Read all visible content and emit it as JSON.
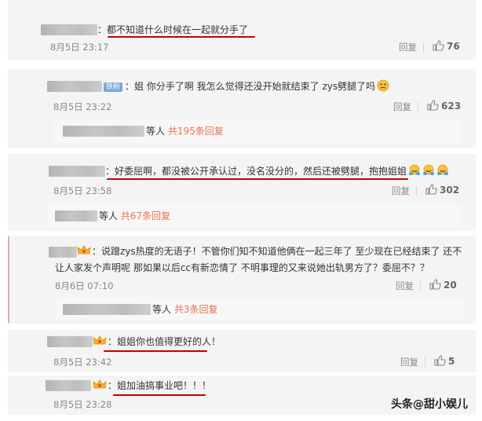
{
  "comments": [
    {
      "text": "：都不知道什么时候在一起就分手了",
      "time": "8月5日 23:17",
      "reply_label": "回复",
      "likes": "76"
    },
    {
      "badge": "铁粉",
      "text": "：姐 你分手了啊 我怎么觉得还没开始就结束了 zys劈腿了吗",
      "time": "8月5日 23:22",
      "reply_label": "回复",
      "likes": "623",
      "replies_prefix": "等人",
      "replies_link": "共195条回复"
    },
    {
      "text": "：好委屈啊，都没被公开承认过，没名没分的，然后还被劈腿，抱抱姐姐",
      "time": "8月5日 23:58",
      "reply_label": "回复",
      "likes": "302",
      "replies_prefix": "等人",
      "replies_link": "共67条回复"
    },
    {
      "text_line1": "：说蹭zys热度的无语子！不管你们知不知道他俩在一起三年了 至少现在已经结束了 还不",
      "text_line2": "让人家发个声明呢 那如果以后cc有新恋情了 不明事理的又来说她出轨男方了？委屈不？？",
      "time": "8月6日 07:10",
      "reply_label": "回复",
      "likes": "20",
      "replies_prefix": "等人",
      "replies_link": "共3条回复"
    },
    {
      "text": "：姐姐你也值得更好的人！",
      "time": "8月5日 23:42",
      "reply_label": "回复",
      "likes": "5"
    },
    {
      "text": "：姐加油搞事业吧！！！",
      "time": "8月5日 23:28"
    }
  ],
  "watermark": "头条@甜小娱儿",
  "colors": {
    "accent": "#eb7350",
    "underline": "#c40000"
  }
}
